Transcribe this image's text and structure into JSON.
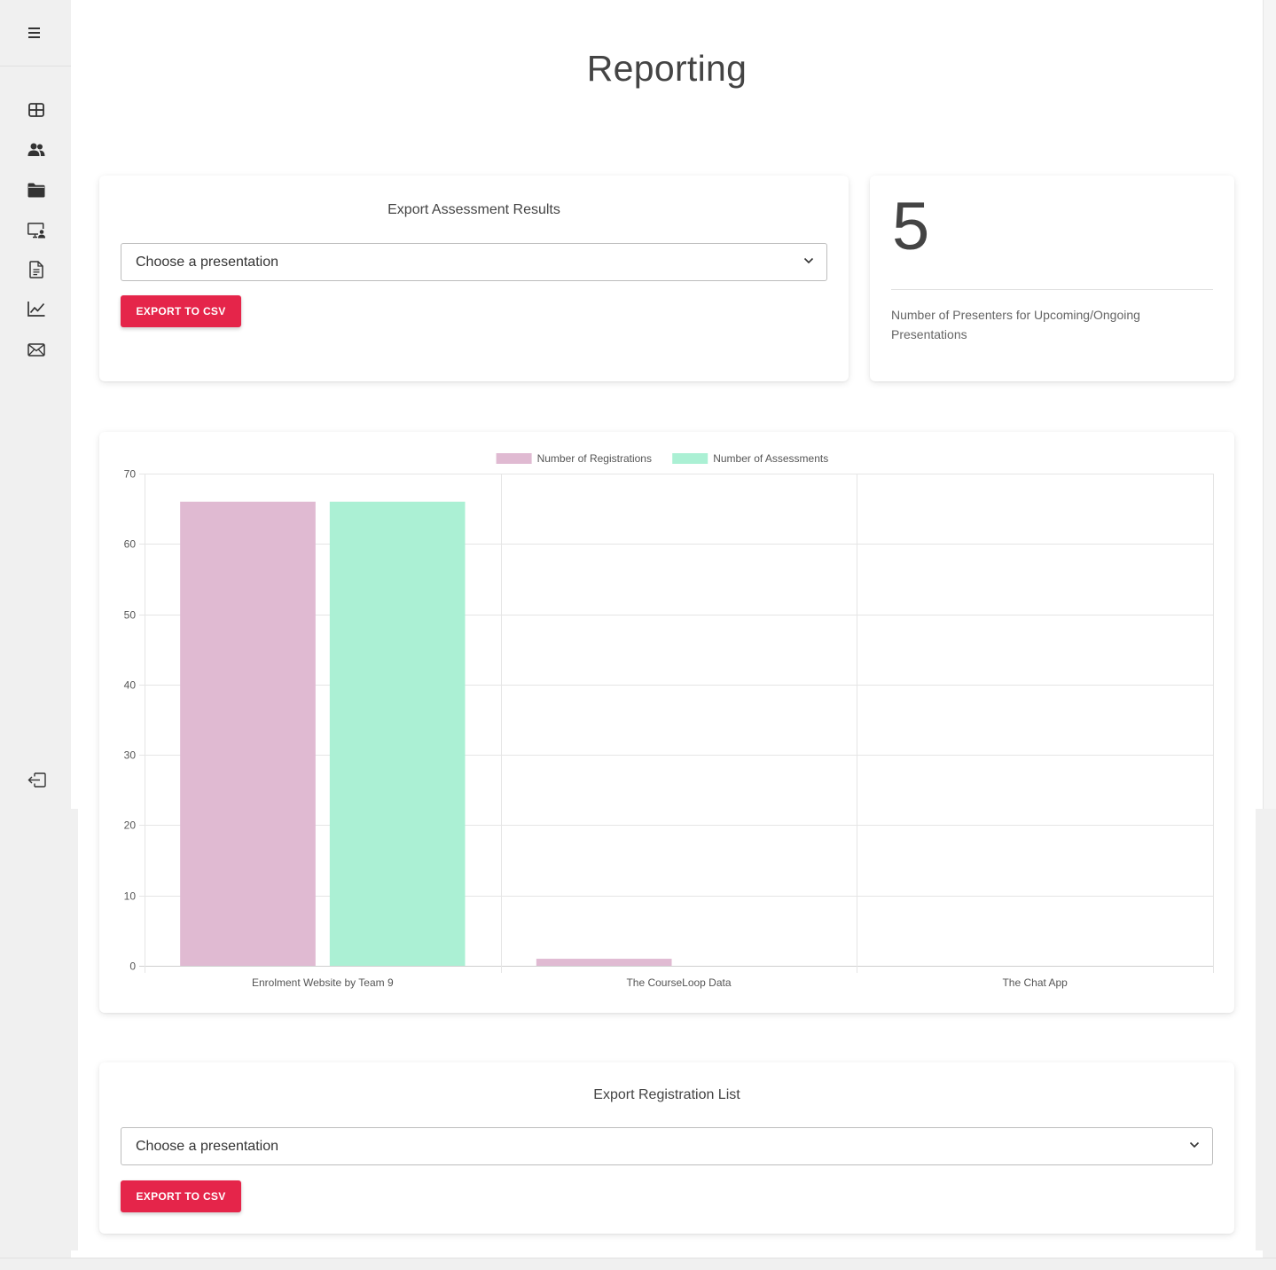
{
  "page": {
    "title": "Reporting"
  },
  "sidebar": {
    "items": [
      {
        "name": "menu-icon"
      },
      {
        "name": "dashboard-grid-icon"
      },
      {
        "name": "users-icon"
      },
      {
        "name": "folder-icon"
      },
      {
        "name": "presentation-screen-icon"
      },
      {
        "name": "document-icon"
      },
      {
        "name": "line-chart-icon"
      },
      {
        "name": "mail-icon"
      },
      {
        "name": "logout-icon"
      }
    ]
  },
  "assessment_export": {
    "title": "Export Assessment Results",
    "select_value": "Choose a presentation",
    "button_label": "EXPORT TO CSV"
  },
  "presenters_stat": {
    "value": "5",
    "label": "Number of Presenters for Upcoming/Ongoing Presentations"
  },
  "registration_export": {
    "title": "Export Registration List",
    "select_value": "Choose a presentation",
    "button_label": "EXPORT TO CSV"
  },
  "colors": {
    "accent": "#e5254a",
    "registrations": "#e0bad2",
    "assessments": "#abf0d4"
  },
  "chart_data": {
    "type": "bar",
    "categories": [
      "Enrolment Website by Team 9",
      "The CourseLoop Data",
      "The Chat App"
    ],
    "series": [
      {
        "name": "Number of Registrations",
        "color": "#e0bad2",
        "values": [
          66,
          1,
          0
        ]
      },
      {
        "name": "Number of Assessments",
        "color": "#abf0d4",
        "values": [
          66,
          0,
          0
        ]
      }
    ],
    "ylim": [
      0,
      70
    ],
    "yticks": [
      0,
      10,
      20,
      30,
      40,
      50,
      60,
      70
    ],
    "grid": true,
    "legend_position": "top"
  }
}
